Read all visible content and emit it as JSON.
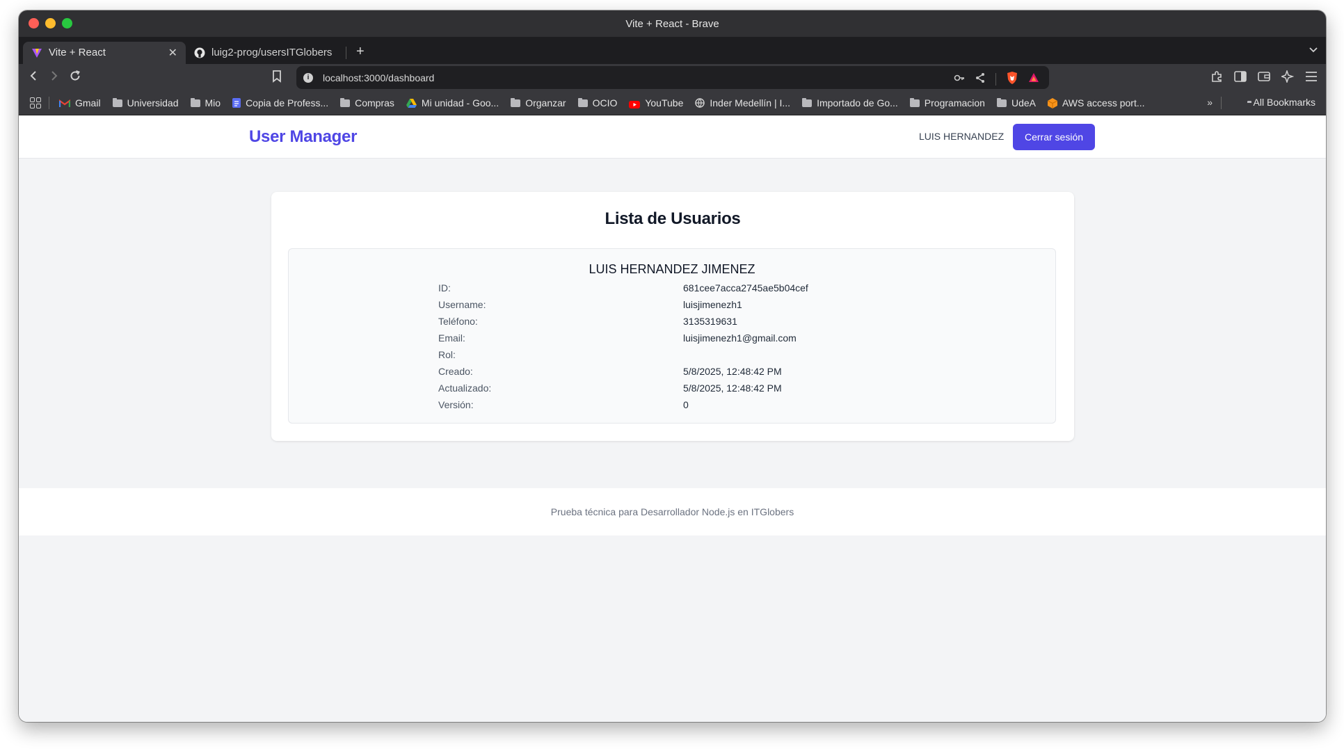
{
  "window": {
    "title": "Vite + React - Brave"
  },
  "tabs": [
    {
      "label": "Vite + React",
      "active": true
    },
    {
      "label": "luig2-prog/usersITGlobers",
      "active": false
    }
  ],
  "address_bar": {
    "url": "localhost:3000/dashboard"
  },
  "bookmarks": [
    {
      "label": "Gmail",
      "icon": "gmail-icon"
    },
    {
      "label": "Universidad",
      "icon": "folder-icon"
    },
    {
      "label": "Mio",
      "icon": "folder-icon"
    },
    {
      "label": "Copia de Profess...",
      "icon": "doc-icon"
    },
    {
      "label": "Compras",
      "icon": "folder-icon"
    },
    {
      "label": "Mi unidad - Goo...",
      "icon": "drive-icon"
    },
    {
      "label": "Organzar",
      "icon": "folder-icon"
    },
    {
      "label": "OCIO",
      "icon": "folder-icon"
    },
    {
      "label": "YouTube",
      "icon": "youtube-icon"
    },
    {
      "label": "Inder Medellín | I...",
      "icon": "globe-icon"
    },
    {
      "label": "Importado de Go...",
      "icon": "folder-icon"
    },
    {
      "label": "Programacion",
      "icon": "folder-icon"
    },
    {
      "label": "UdeA",
      "icon": "folder-icon"
    },
    {
      "label": "AWS access port...",
      "icon": "aws-icon"
    }
  ],
  "bookmarks_more": "»",
  "all_bookmarks": "All Bookmarks",
  "app": {
    "brand": "User Manager",
    "current_user": "LUIS HERNANDEZ",
    "logout_label": "Cerrar sesión",
    "accent": "#4f46e5"
  },
  "list": {
    "title": "Lista de Usuarios",
    "users": [
      {
        "full_name": "LUIS HERNANDEZ JIMENEZ",
        "fields": [
          {
            "label": "ID:",
            "value": "681cee7acca2745ae5b04cef"
          },
          {
            "label": "Username:",
            "value": "luisjimenezh1"
          },
          {
            "label": "Teléfono:",
            "value": "3135319631"
          },
          {
            "label": "Email:",
            "value": "luisjimenezh1@gmail.com"
          },
          {
            "label": "Rol:",
            "value": ""
          },
          {
            "label": "Creado:",
            "value": "5/8/2025, 12:48:42 PM"
          },
          {
            "label": "Actualizado:",
            "value": "5/8/2025, 12:48:42 PM"
          },
          {
            "label": "Versión:",
            "value": "0"
          }
        ]
      }
    ]
  },
  "footer": {
    "text": "Prueba técnica para Desarrollador Node.js en ITGlobers"
  }
}
